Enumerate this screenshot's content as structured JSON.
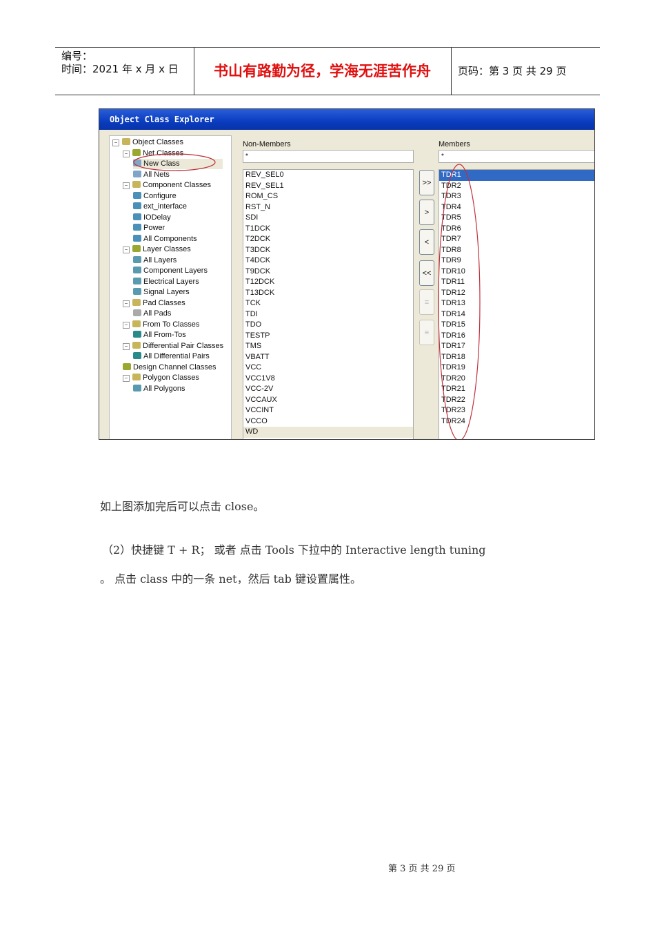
{
  "header": {
    "number_label": "编号：",
    "time_label": "时间：2021 年 x 月 x 日",
    "motto": "书山有路勤为径，学海无涯苦作舟",
    "page_label": "页码：第 3 页 共 29 页"
  },
  "screenshot": {
    "title": "Object Class Explorer",
    "tree": [
      {
        "label": "Object Classes",
        "level": 0,
        "expander": "−",
        "icon_color": "#c8b45a"
      },
      {
        "label": "Net Classes",
        "level": 1,
        "expander": "−",
        "icon_color": "#9aa830"
      },
      {
        "label": "New Class",
        "level": 2,
        "icon_color": "#7fa6c8",
        "highlight": true
      },
      {
        "label": "All Nets",
        "level": 2,
        "icon_color": "#7fa6c8"
      },
      {
        "label": "Component Classes",
        "level": 1,
        "expander": "−",
        "icon_color": "#c8b45a"
      },
      {
        "label": "Configure",
        "level": 2,
        "icon_color": "#4a90b8"
      },
      {
        "label": "ext_interface",
        "level": 2,
        "icon_color": "#4a90b8"
      },
      {
        "label": "IODelay",
        "level": 2,
        "icon_color": "#4a90b8"
      },
      {
        "label": "Power",
        "level": 2,
        "icon_color": "#4a90b8"
      },
      {
        "label": "All Components",
        "level": 2,
        "icon_color": "#4a90b8"
      },
      {
        "label": "Layer Classes",
        "level": 1,
        "expander": "−",
        "icon_color": "#9aa830"
      },
      {
        "label": "All Layers",
        "level": 2,
        "icon_color": "#5a9ab0"
      },
      {
        "label": "Component Layers",
        "level": 2,
        "icon_color": "#5a9ab0"
      },
      {
        "label": "Electrical Layers",
        "level": 2,
        "icon_color": "#5a9ab0"
      },
      {
        "label": "Signal Layers",
        "level": 2,
        "icon_color": "#5a9ab0"
      },
      {
        "label": "Pad Classes",
        "level": 1,
        "expander": "−",
        "icon_color": "#c8b45a"
      },
      {
        "label": "All Pads",
        "level": 2,
        "icon_color": "#aaaaaa"
      },
      {
        "label": "From To Classes",
        "level": 1,
        "expander": "−",
        "icon_color": "#c8b45a"
      },
      {
        "label": "All From-Tos",
        "level": 2,
        "icon_color": "#2a8a8a"
      },
      {
        "label": "Differential Pair Classes",
        "level": 1,
        "expander": "−",
        "icon_color": "#c8b45a"
      },
      {
        "label": "All Differential Pairs",
        "level": 2,
        "icon_color": "#2a8a8a"
      },
      {
        "label": "Design Channel Classes",
        "level": 1,
        "icon_color": "#9aa830"
      },
      {
        "label": "Polygon Classes",
        "level": 1,
        "expander": "−",
        "icon_color": "#c8b45a"
      },
      {
        "label": "All Polygons",
        "level": 2,
        "icon_color": "#5a9ab0"
      }
    ],
    "non_members": {
      "label": "Non-Members",
      "filter": "*",
      "items": [
        "REV_SEL0",
        "REV_SEL1",
        "ROM_CS",
        "RST_N",
        "SDI",
        "T1DCK",
        "T2DCK",
        "T3DCK",
        "T4DCK",
        "T9DCK",
        "T12DCK",
        "T13DCK",
        "TCK",
        "TDI",
        "TDO",
        "TESTP",
        "TMS",
        "VBATT",
        "VCC",
        "VCC1V8",
        "VCC-2V",
        "VCCAUX",
        "VCCINT",
        "VCCO",
        "WD"
      ]
    },
    "buttons": [
      ">>",
      ">",
      "<",
      "<<",
      "",
      ""
    ],
    "members": {
      "label": "Members",
      "filter": "*",
      "items": [
        "TDR1",
        "TDR2",
        "TDR3",
        "TDR4",
        "TDR5",
        "TDR6",
        "TDR7",
        "TDR8",
        "TDR9",
        "TDR10",
        "TDR11",
        "TDR12",
        "TDR13",
        "TDR14",
        "TDR15",
        "TDR16",
        "TDR17",
        "TDR18",
        "TDR19",
        "TDR20",
        "TDR21",
        "TDR22",
        "TDR23",
        "TDR24"
      ],
      "selected": "TDR1"
    },
    "annotation_color": "#c0303a"
  },
  "body": {
    "p1": "如上图添加完后可以点击 close。",
    "p2": "（2）快捷键 T + R； 或者 点击 Tools 下拉中的 Interactive length tuning",
    "p3": "。 点击 class 中的一条 net，然后 tab 键设置属性。"
  },
  "footer": "第 3 页 共 29 页"
}
